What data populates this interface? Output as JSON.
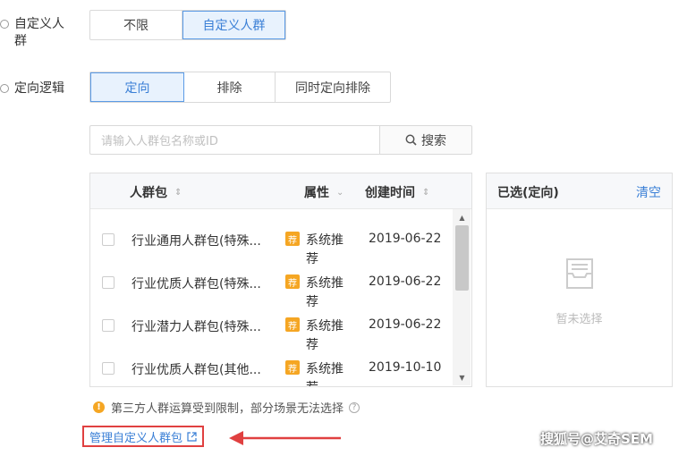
{
  "crowd_row": {
    "label_line1": "自定义人",
    "label_line2": "群",
    "options": [
      "不限",
      "自定义人群"
    ],
    "selected": "自定义人群"
  },
  "logic_row": {
    "label": "定向逻辑",
    "options": [
      "定向",
      "排除",
      "同时定向排除"
    ],
    "selected": "定向"
  },
  "search": {
    "placeholder": "请输入人群包名称或ID",
    "button_label": "搜索"
  },
  "table": {
    "headers": {
      "name": "人群包",
      "attr": "属性",
      "created": "创建时间"
    },
    "rows": [
      {
        "name": "行业通用人群包(特殊...",
        "tag": "荐",
        "attr": "系统推荐",
        "date": "2019-06-22"
      },
      {
        "name": "行业优质人群包(特殊...",
        "tag": "荐",
        "attr": "系统推荐",
        "date": "2019-06-22"
      },
      {
        "name": "行业潜力人群包(特殊...",
        "tag": "荐",
        "attr": "系统推荐",
        "date": "2019-06-22"
      },
      {
        "name": "行业优质人群包(其他...",
        "tag": "荐",
        "attr": "系统推荐",
        "date": "2019-10-10"
      }
    ]
  },
  "selected_panel": {
    "title": "已选(定向)",
    "clear_label": "清空",
    "empty_text": "暂未选择"
  },
  "notice": {
    "text": "第三方人群运算受到限制，部分场景无法选择"
  },
  "manage_link": {
    "label": "管理自定义人群包"
  },
  "watermark": {
    "text": "搜狐号@艾奇SEM"
  },
  "colors": {
    "accent": "#3a7fd6",
    "active_bg": "#e8f2fd",
    "tag": "#f5a623",
    "highlight": "#e04040"
  }
}
